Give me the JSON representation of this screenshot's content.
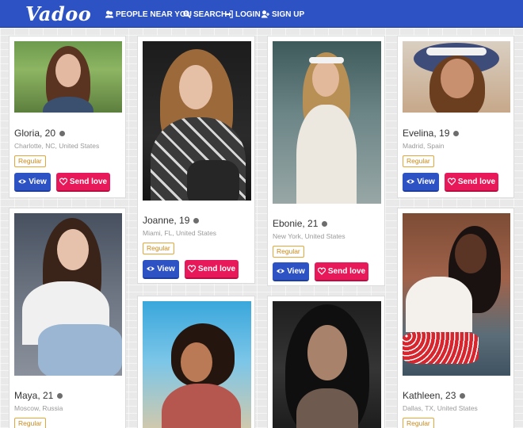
{
  "brand": {
    "logo": "Vadoo"
  },
  "nav": {
    "people_near_you": "PEOPLE NEAR YOU",
    "search": "SEARCH",
    "login": "LOGIN",
    "signup": "SIGN UP"
  },
  "labels": {
    "view": "View",
    "send_love": "Send love"
  },
  "colors": {
    "primary": "#2d52c4",
    "love": "#e8195a",
    "badge": "#e3a63b"
  },
  "profiles": [
    {
      "name": "Gloria, 20",
      "location": "Charlotte, NC, United States",
      "badge": "Regular"
    },
    {
      "name": "Joanne, 19",
      "location": "Miami, FL, United States",
      "badge": "Regular"
    },
    {
      "name": "Ebonie, 21",
      "location": "New York, United States",
      "badge": "Regular"
    },
    {
      "name": "Evelina, 19",
      "location": "Madrid, Spain",
      "badge": "Regular"
    },
    {
      "name": "Maya, 21",
      "location": "Moscow, Russia",
      "badge": "Regular"
    },
    {
      "name": "Kathleen, 23",
      "location": "Dallas, TX, United States",
      "badge": "Regular"
    }
  ]
}
